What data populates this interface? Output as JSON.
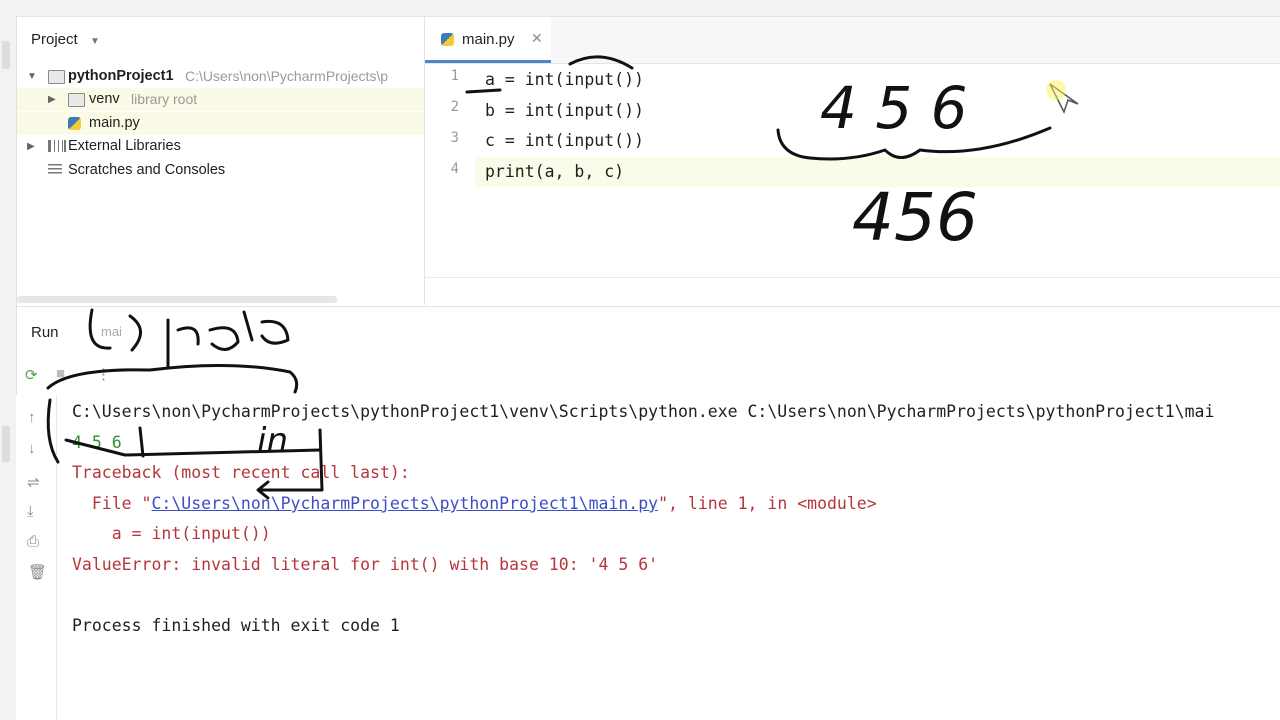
{
  "project_panel": {
    "title": "Project",
    "tree": [
      {
        "label": "pythonProject1",
        "hint": "C:\\Users\\non\\PycharmProjects\\p"
      },
      {
        "label": "venv",
        "hint": "library root"
      },
      {
        "label": "main.py",
        "hint": ""
      },
      {
        "label": "External Libraries",
        "hint": ""
      },
      {
        "label": "Scratches and Consoles",
        "hint": ""
      }
    ]
  },
  "editor": {
    "tab_label": "main.py",
    "tab_close": "✕",
    "line_numbers": [
      "1",
      "2",
      "3",
      "4"
    ],
    "code_lines": [
      "a = int(input())",
      "b = int(input())",
      "c = int(input())",
      "print(a, b, c)"
    ]
  },
  "run_panel": {
    "title": "Run",
    "tab": "mai",
    "output_lines": [
      "C:\\Users\\non\\PycharmProjects\\pythonProject1\\venv\\Scripts\\python.exe C:\\Users\\non\\PycharmProjects\\pythonProject1\\mai",
      "4 5 6",
      "Traceback (most recent call last):",
      "  File \"",
      "C:\\Users\\non\\PycharmProjects\\pythonProject1\\main.py",
      "\", line 1, in <module>",
      "    a = int(input())",
      "ValueError: invalid literal for int() with base 10: '4 5 6'",
      "",
      "Process finished with exit code 1"
    ]
  },
  "annotations": {
    "handwritten_top": "4 5 6",
    "handwritten_bottom": "456",
    "handwritten_label": "строка",
    "handwritten_in": "in"
  },
  "colors": {
    "accent": "#4a86c8",
    "error_text": "#b5363c",
    "input_text": "#2f8f2f",
    "link": "#3b4fc4"
  }
}
